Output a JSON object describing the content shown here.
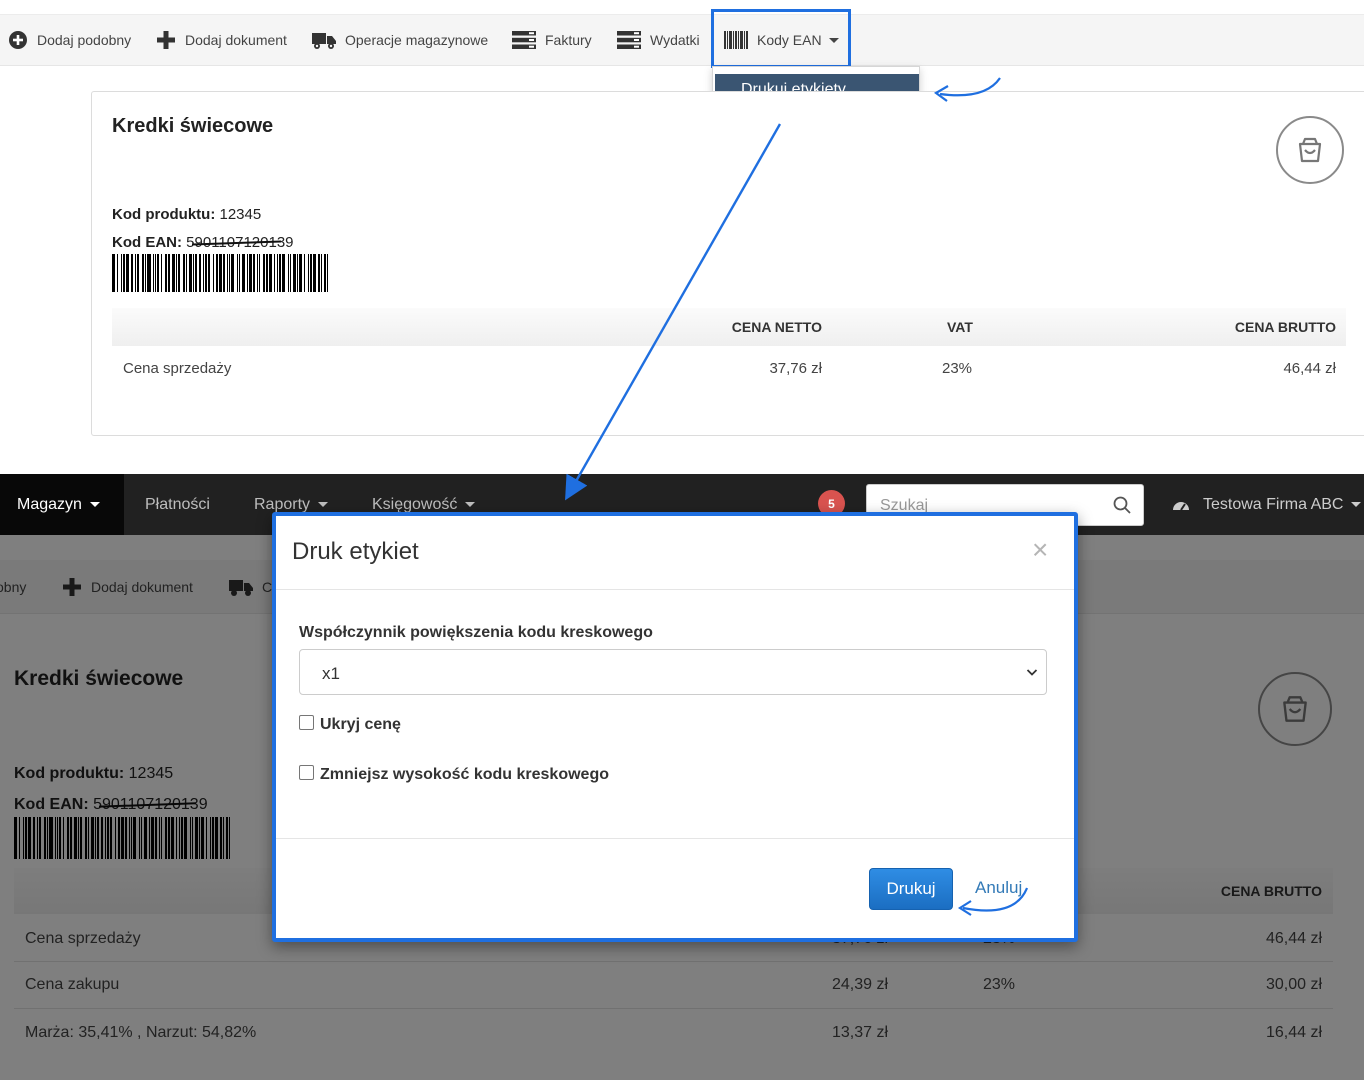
{
  "top_toolbar": {
    "items": [
      {
        "label": "Dodaj podobny",
        "icon": "plus-circle-icon"
      },
      {
        "label": "Dodaj dokument",
        "icon": "plus-icon"
      },
      {
        "label": "Operacje magazynowe",
        "icon": "truck-icon"
      },
      {
        "label": "Faktury",
        "icon": "list-icon"
      },
      {
        "label": "Wydatki",
        "icon": "list-icon"
      },
      {
        "label": "Kody EAN",
        "icon": "barcode-icon"
      }
    ],
    "dropdown_item": "Drukuj etykiety"
  },
  "product_card_top": {
    "title": "Kredki świecowe",
    "product_code_label": "Kod produktu:",
    "product_code": "12345",
    "ean_label": "Kod EAN:",
    "ean_value": "5901107120139",
    "table_headers": [
      "CENA NETTO",
      "VAT",
      "CENA BRUTTO"
    ],
    "rows": [
      {
        "label": "Cena sprzedaży",
        "netto": "37,76 zł",
        "vat": "23%",
        "brutto": "46,44 zł"
      }
    ]
  },
  "navbar": {
    "items": [
      {
        "label": "Magazyn",
        "dropdown": true
      },
      {
        "label": "Płatności",
        "dropdown": false
      },
      {
        "label": "Raporty",
        "dropdown": true
      },
      {
        "label": "Księgowość",
        "dropdown": true
      }
    ],
    "badge": "5",
    "search_placeholder": "Szukaj",
    "company": "Testowa Firma ABC"
  },
  "bottom_toolbar": {
    "items": [
      {
        "label": "obny"
      },
      {
        "label": "Dodaj dokument"
      },
      {
        "label": "C"
      }
    ]
  },
  "product_card_bottom": {
    "title": "Kredki świecowe",
    "product_code_label": "Kod produktu:",
    "product_code": "12345",
    "ean_label": "Kod EAN:",
    "ean_value": "5901107120139",
    "header_brutto": "CENA BRUTTO",
    "rows": [
      {
        "label": "Cena sprzedaży",
        "netto": "37,76 zł",
        "vat": "23%",
        "brutto": "46,44 zł"
      },
      {
        "label": "Cena zakupu",
        "netto": "24,39 zł",
        "vat": "23%",
        "brutto": "30,00 zł"
      },
      {
        "label": "Marża: 35,41% , Narzut: 54,82%",
        "netto": "13,37 zł",
        "vat": "",
        "brutto": "16,44 zł"
      }
    ]
  },
  "modal": {
    "title": "Druk etykiet",
    "close": "×",
    "scale_label": "Współczynnik powiększenia kodu kreskowego",
    "scale_value": "x1",
    "hide_price_label": "Ukryj cenę",
    "reduce_height_label": "Zmniejsz wysokość kodu kreskowego",
    "print_button": "Drukuj",
    "cancel_link": "Anuluj"
  },
  "colors": {
    "highlight_blue": "#1f6fe0",
    "dropdown_active": "#3a5572",
    "navbar_bg": "#212121",
    "primary_button": "#1b6ec2",
    "badge_red": "#d9534f"
  }
}
